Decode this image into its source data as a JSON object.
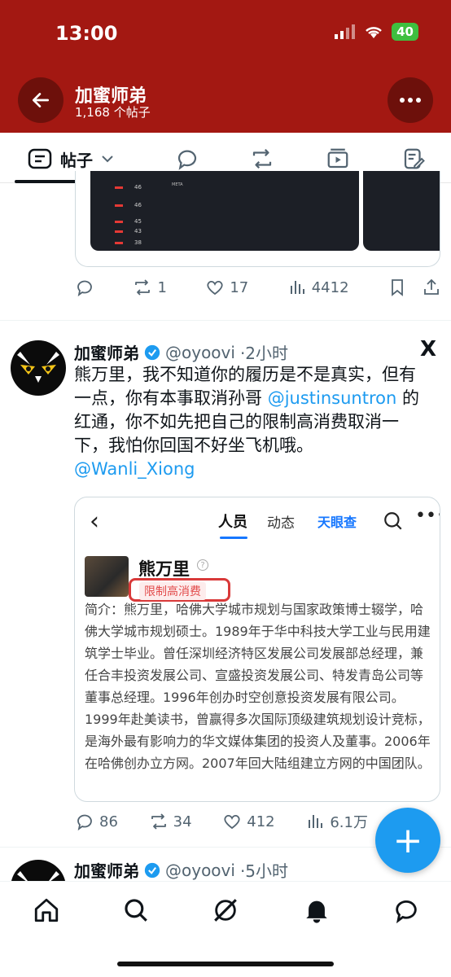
{
  "status": {
    "time": "13:00",
    "battery": "40"
  },
  "header": {
    "title": "加蜜师弟",
    "subtitle": "1,168 个帖子"
  },
  "tabs": {
    "posts_label": "帖子"
  },
  "prev_tweet": {
    "image_rows": [
      "46",
      "46",
      "45",
      "43",
      "38"
    ],
    "image_caption": "META",
    "reply_count": "",
    "retweet_count": "1",
    "like_count": "17",
    "view_count": "4412"
  },
  "tweet": {
    "author_name": "加蜜师弟",
    "handle": "@oyoovi",
    "time": "·2小时",
    "text_1": "熊万里，我不知道你的履历是不是真实，但有一点，你有本事取消孙哥 ",
    "mention_1": "@justinsuntron",
    "text_2": " 的红通，你不如先把自己的限制高消费取消一下，我怕你回国不好坐飞机哦。",
    "mention_2": "@Wanli_Xiong",
    "embed": {
      "tab_people": "人员",
      "tab_news": "动态",
      "brand": "天眼查",
      "person_name": "熊万里",
      "restrict_label": "限制高消费",
      "bio": "简介：熊万里，哈佛大学城市规划与国家政策博士辍学，哈佛大学城市规划硕士。1989年于华中科技大学工业与民用建筑学士毕业。曾任深圳经济特区发展公司发展部总经理，兼任合丰投资发展公司、宣盛投资发展公司、特发青岛公司等董事总经理。1996年创办时空创意投资发展有限公司。1999年赴美读书，曾赢得多次国际顶级建筑规划设计竞标，是海外最有影响力的华文媒体集团的投资人及董事。2006年在哈佛创办立方网。2007年回大陆组建立方网的中国团队。"
    },
    "reply_count": "86",
    "retweet_count": "34",
    "like_count": "412",
    "view_count": "6.1万"
  },
  "next_tweet": {
    "author_name": "加蜜师弟",
    "handle": "@oyoovi",
    "time": "·5小时"
  },
  "icons": {
    "back": "back-arrow-icon",
    "more": "more-icon",
    "x_logo": "X",
    "fab": "+"
  },
  "colors": {
    "header_bg": "#a31812",
    "link": "#1d9bf0",
    "fab": "#1d9bf0",
    "verified": "#1d9bf0"
  }
}
